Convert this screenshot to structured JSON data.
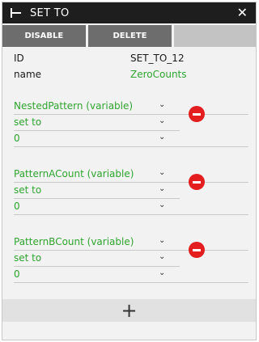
{
  "window": {
    "title": "SET TO",
    "title_icon": "pin-icon",
    "close_icon": "close-icon"
  },
  "toolbar": {
    "disable_label": "DISABLE",
    "delete_label": "DELETE"
  },
  "properties": [
    {
      "key": "ID",
      "value": "SET_TO_12"
    },
    {
      "key": "name",
      "value": "ZeroCounts"
    }
  ],
  "assignments": [
    {
      "variable": "NestedPattern (variable)",
      "operator": "set to",
      "value": "0"
    },
    {
      "variable": "PatternACount (variable)",
      "operator": "set to",
      "value": "0"
    },
    {
      "variable": "PatternBCount (variable)",
      "operator": "set to",
      "value": "0"
    }
  ],
  "add_icon": "plus-icon",
  "colors": {
    "titlebar": "#1e1e1e",
    "toolbar_button": "#6d6d6d",
    "accent_green": "#2fa52f",
    "remove_red": "#e41e1e"
  }
}
